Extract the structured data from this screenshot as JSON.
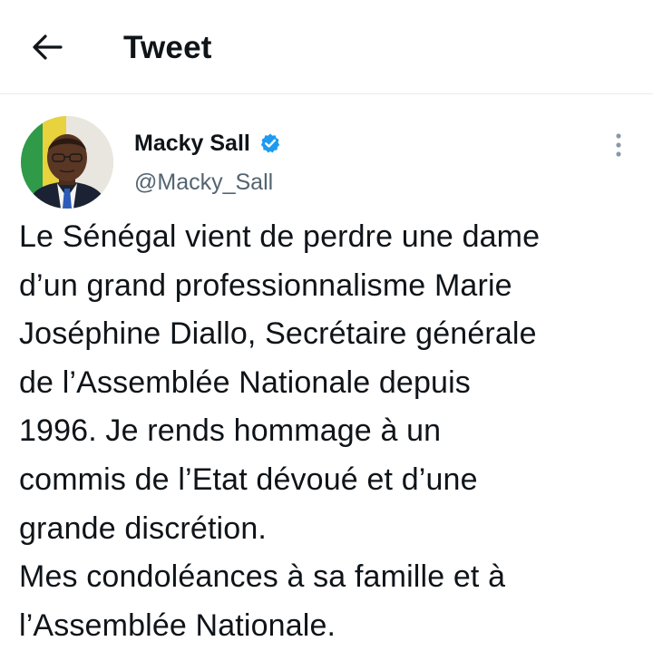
{
  "header": {
    "title": "Tweet",
    "back_icon": "arrow-left-icon"
  },
  "tweet": {
    "author": {
      "name": "Macky Sall",
      "handle": "@Macky_Sall",
      "verified": true,
      "verified_icon": "verified-badge-icon",
      "verified_color": "#1d9bf0"
    },
    "more_icon": "more-vertical-icon",
    "text_lines": [
      "Le Sénégal vient de perdre une dame",
      "d’un grand professionnalisme Marie",
      "Joséphine Diallo, Secrétaire générale",
      "de l’Assemblée Nationale depuis",
      "1996. Je rends hommage à un",
      "commis de l’Etat dévoué et d’une",
      "grande discrétion.",
      "Mes condoléances à sa famille et à",
      "l’Assemblée Nationale."
    ]
  },
  "colors": {
    "text_primary": "#0f1419",
    "text_secondary": "#536471",
    "divider": "#e6ecf0"
  }
}
